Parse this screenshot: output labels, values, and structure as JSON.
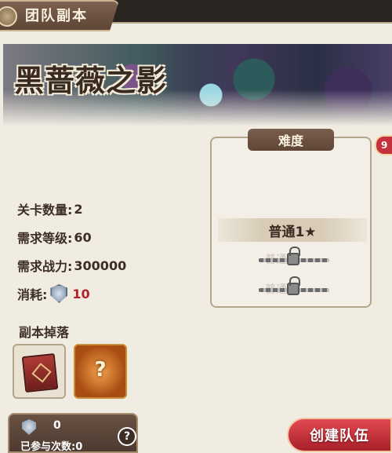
{
  "header": {
    "title": "团队副本"
  },
  "dungeon": {
    "name": "黑蔷薇之影"
  },
  "stats": {
    "stage_count_label": "关卡数量:",
    "stage_count": "2",
    "level_label": "需求等级:",
    "level": "60",
    "power_label": "需求战力:",
    "power": "300000",
    "cost_label": "消耗:",
    "cost": "10"
  },
  "drops": {
    "title": "副本掉落",
    "mystery_label": "?"
  },
  "difficulty": {
    "title": "难度",
    "selected": "普通1★",
    "locked_1": "普通2",
    "locked_2": "普通3"
  },
  "side_badge": "9",
  "bottom": {
    "ticket_count": "0",
    "participation": "已参与次数:0",
    "help_label": "?"
  },
  "create_team_button": "创建队伍",
  "colors": {
    "accent": "#c5323b",
    "frame": "#5e4536",
    "panel": "#f1ece2"
  }
}
